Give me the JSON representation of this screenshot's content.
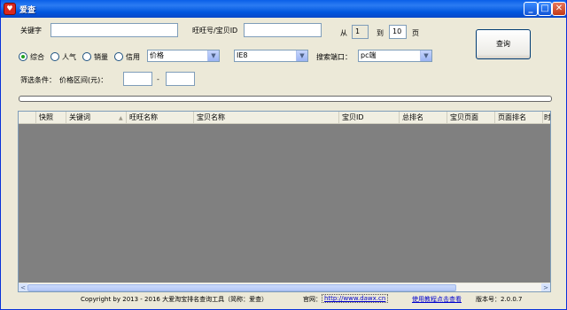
{
  "window": {
    "title": "爱查",
    "app_icon_glyph": "♥",
    "minimize_glyph": "_",
    "maximize_glyph": "□",
    "close_glyph": "✕"
  },
  "search": {
    "keyword_label": "关键字",
    "keyword_value": "",
    "wangwang_label": "旺旺号/宝贝ID",
    "wangwang_value": "",
    "from_label": "从",
    "from_value": "1",
    "to_label": "到",
    "to_value": "10",
    "page_label": "页",
    "query_button": "查询"
  },
  "sort_options": [
    {
      "label": "综合",
      "selected": true
    },
    {
      "label": "人气",
      "selected": false
    },
    {
      "label": "销量",
      "selected": false
    },
    {
      "label": "信用",
      "selected": false
    }
  ],
  "filters": {
    "price_select": "价格",
    "browser_select": "IE8",
    "port_label": "搜索端口：",
    "port_select": "pc端",
    "condition_label": "筛选条件：",
    "price_range_label": "价格区间(元)：",
    "price_min": "",
    "price_sep": "-",
    "price_max": ""
  },
  "progress": {
    "value": 0
  },
  "grid": {
    "columns": [
      "快照",
      "关键词",
      "旺旺名称",
      "宝贝名称",
      "宝贝ID",
      "总排名",
      "宝贝页面",
      "页面排名",
      "时"
    ],
    "sort_indicator": "▲",
    "scroll_left": "<",
    "scroll_right": ">"
  },
  "footer": {
    "copyright": "Copyright by 2013 - 2016 大爱淘宝排名查询工具（简称：爱查）",
    "site_label": "官网：",
    "site_url": "http://www.dawx.cn",
    "tutorial_link": "使用教程点击查看",
    "version_label": "版本号：2.0.0.7"
  },
  "colors": {
    "title_bar": "#0A5FE8",
    "window_bg": "#ECE9D8",
    "grid_bg": "#808080",
    "link": "#0000CC"
  }
}
